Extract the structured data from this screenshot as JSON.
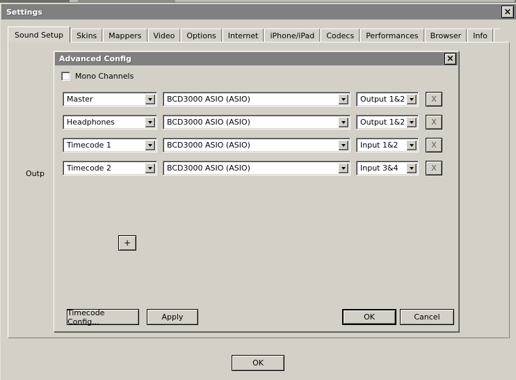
{
  "settings_window": {
    "title": "Settings",
    "close_icon": "close-icon",
    "close_glyph": "×",
    "ok_label": "OK",
    "tabs": [
      {
        "label": "Sound Setup",
        "selected": true
      },
      {
        "label": "Skins",
        "selected": false
      },
      {
        "label": "Mappers",
        "selected": false
      },
      {
        "label": "Video",
        "selected": false
      },
      {
        "label": "Options",
        "selected": false
      },
      {
        "label": "Internet",
        "selected": false
      },
      {
        "label": "iPhone/iPad",
        "selected": false
      },
      {
        "label": "Codecs",
        "selected": false
      },
      {
        "label": "Performances",
        "selected": false
      },
      {
        "label": "Browser",
        "selected": false
      },
      {
        "label": "Info",
        "selected": false
      }
    ],
    "outputs_label": "Outp"
  },
  "advanced_config": {
    "title": "Advanced Config",
    "close_icon": "close-icon",
    "close_glyph": "×",
    "mono_channels": {
      "label": "Mono Channels",
      "checked": false
    },
    "remove_button_label": "X",
    "add_button_label": "+",
    "rows": [
      {
        "bus": "Master",
        "device": "BCD3000 ASIO (ASIO)",
        "channel": "Output 1&2",
        "remove": "X"
      },
      {
        "bus": "Headphones",
        "device": "BCD3000 ASIO (ASIO)",
        "channel": "Output 1&2",
        "remove": "X"
      },
      {
        "bus": "Timecode 1",
        "device": "BCD3000 ASIO (ASIO)",
        "channel": "Input 1&2",
        "remove": "X"
      },
      {
        "bus": "Timecode 2",
        "device": "BCD3000 ASIO (ASIO)",
        "channel": "Input 3&4",
        "remove": "X"
      }
    ],
    "buttons": {
      "timecode_config": "Timecode Config...",
      "apply": "Apply",
      "ok": "OK",
      "cancel": "Cancel"
    }
  },
  "colors": {
    "face": "#d4d0c8",
    "titlebar": "#808080",
    "titlebar_text": "#ffffff",
    "field": "#ffffff",
    "text": "#000000"
  }
}
